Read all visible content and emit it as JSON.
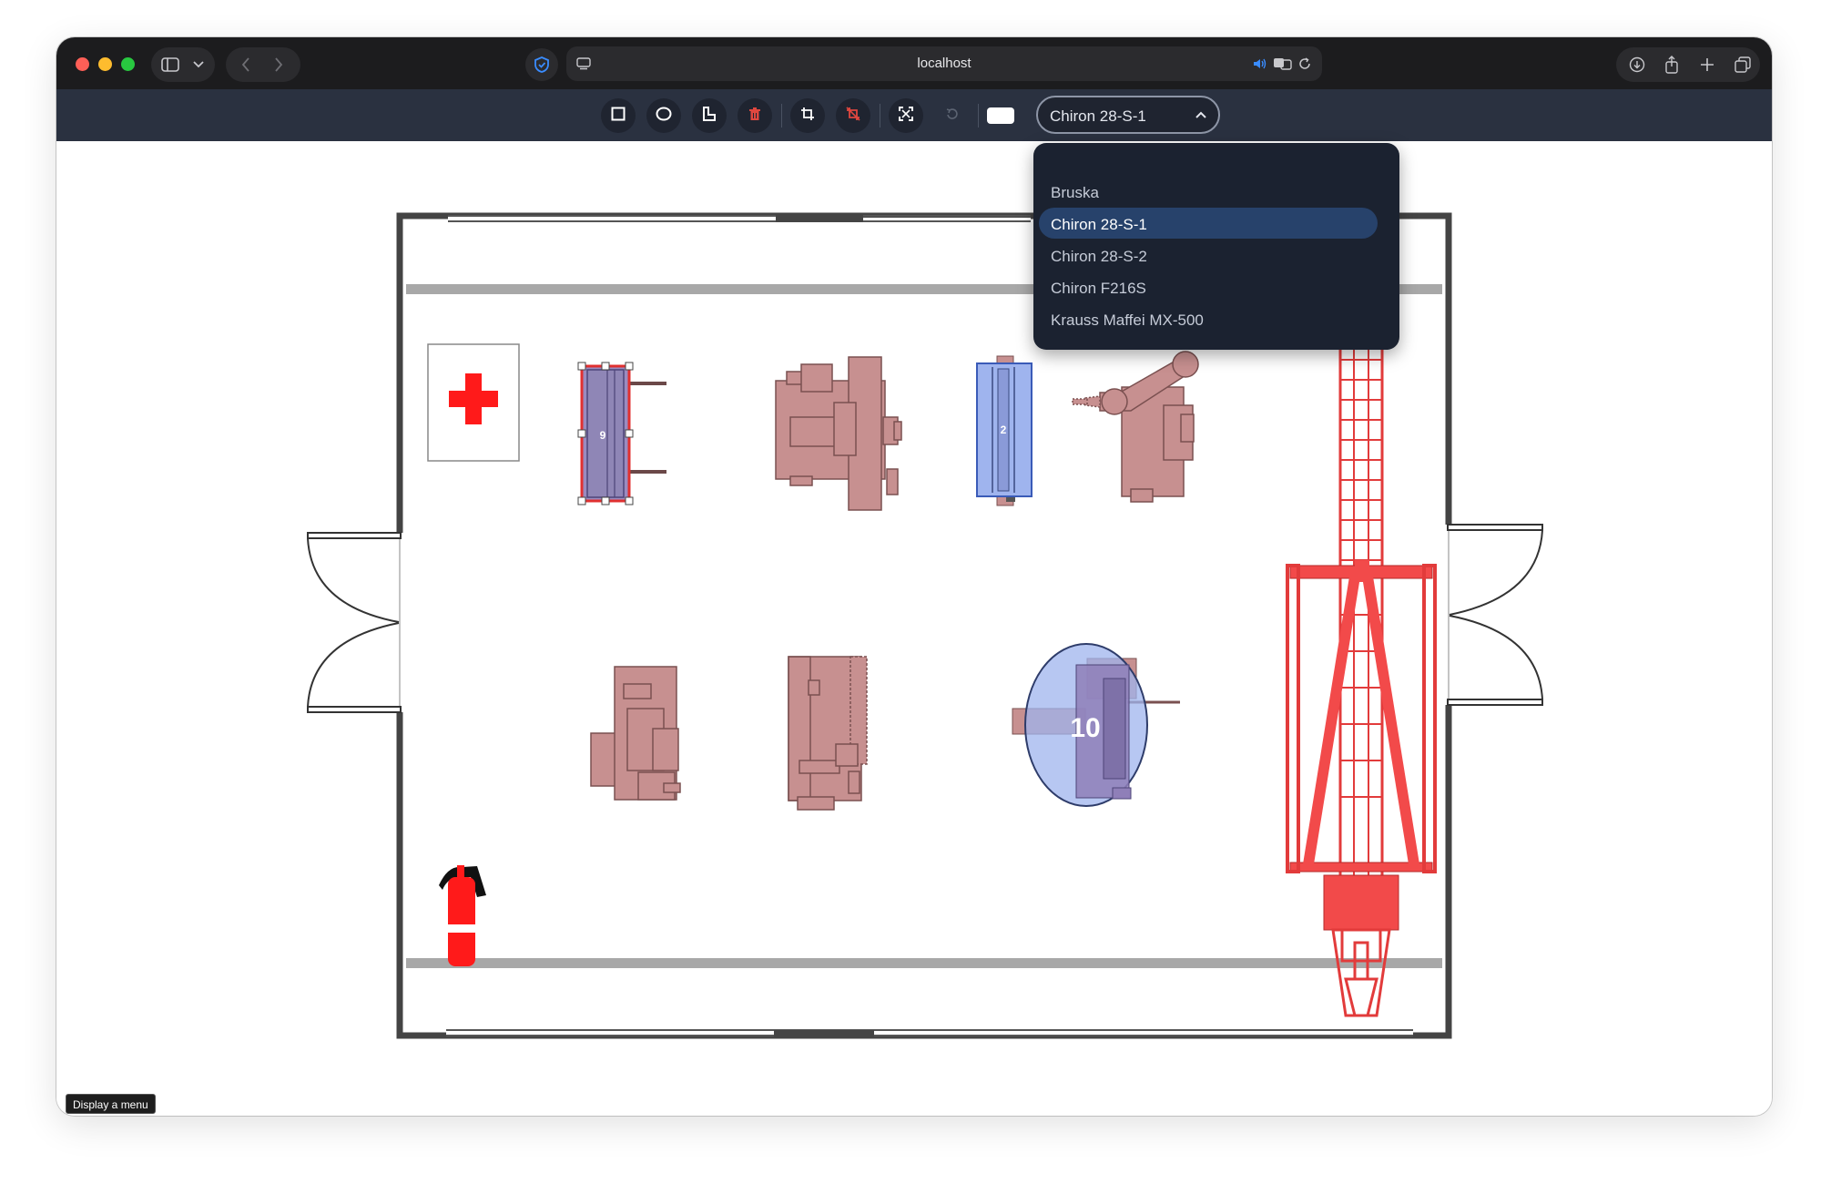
{
  "browser": {
    "address": "localhost"
  },
  "toolbar": {
    "tools": [
      {
        "name": "rectangle-tool",
        "icon": "square-icon"
      },
      {
        "name": "ellipse-tool",
        "icon": "circle-icon"
      },
      {
        "name": "polygon-tool",
        "icon": "l-shape-icon"
      },
      {
        "name": "delete-tool",
        "icon": "trash-icon"
      },
      {
        "name": "crop-tool",
        "icon": "crop-icon"
      },
      {
        "name": "crop-remove-tool",
        "icon": "crop-off-icon"
      },
      {
        "name": "fit-screen-tool",
        "icon": "fullscreen-icon"
      },
      {
        "name": "undo-tool",
        "icon": "undo-icon"
      },
      {
        "name": "color-swatch",
        "icon": "swatch-icon"
      }
    ],
    "machine_select": {
      "value": "Chiron 28-S-1"
    }
  },
  "dropdown": {
    "options": [
      "Bruska",
      "Chiron 28-S-1",
      "Chiron 28-S-2",
      "Chiron F216S",
      "Krauss Maffei MX-500"
    ],
    "selected": "Chiron 28-S-1"
  },
  "floorplan": {
    "labels": {
      "machine_a": "9",
      "machine_b": "2",
      "machine_c": "10"
    }
  },
  "tooltip": {
    "text": "Display a menu"
  },
  "colors": {
    "titlebar": "#1c1c1e",
    "toolbar": "#2a3140",
    "menu_bg": "#1b2230",
    "menu_selected": "#27426b",
    "machine_fill": "#c79090",
    "crane_red": "#f24a4a",
    "selection_blue": "#9fb4ee"
  }
}
